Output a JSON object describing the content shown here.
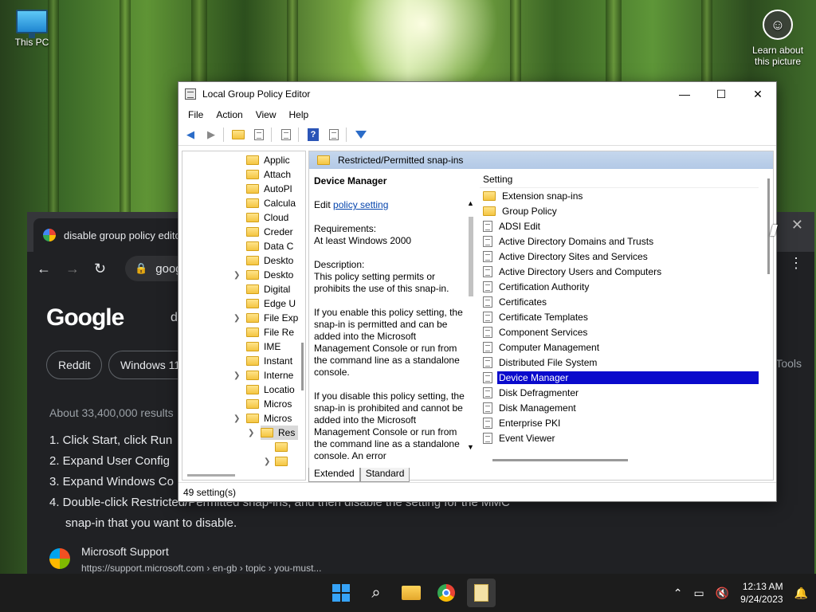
{
  "desktop": {
    "this_pc": "This PC",
    "learn_line1": "Learn about",
    "learn_line2": "this picture"
  },
  "chrome": {
    "tab_title": "disable group policy editor",
    "url": "google.",
    "google_logo": "Google",
    "search_partial": "d",
    "chips": [
      "Reddit",
      "Windows 11"
    ],
    "tools": "Tools",
    "results_count": "About 33,400,000 results",
    "steps": [
      "1. Click Start, click Run",
      "2. Expand User Config",
      "3. Expand Windows Co",
      "4. Double-click Restricted/Permitted snap-ins, and then disable the setting for the MMC",
      "snap-in that you want to disable."
    ],
    "ms_title": "Microsoft Support",
    "ms_url": "https://support.microsoft.com › en-gb › topic › you-must..."
  },
  "gpo": {
    "title": "Local Group Policy Editor",
    "menu": [
      "File",
      "Action",
      "View",
      "Help"
    ],
    "tree_items": [
      "Applic",
      "Attach",
      "AutoPl",
      "Calcula",
      "Cloud",
      "Creder",
      "Data C",
      "Deskto",
      "Deskto",
      "Digital",
      "Edge U",
      "File Exp",
      "File Re",
      "IME",
      "Instant",
      "Interne",
      "Locatio",
      "Micros",
      "Micros",
      "Res",
      "",
      ""
    ],
    "header_path": "Restricted/Permitted snap-ins",
    "desc": {
      "title": "Device Manager",
      "edit_prefix": "Edit ",
      "edit_link": "policy setting",
      "requirements_label": "Requirements:",
      "requirements": "At least Windows 2000",
      "description_label": "Description:",
      "description": "This policy setting permits or prohibits the use of this snap-in.",
      "enable": "If you enable this policy setting, the snap-in is permitted and can be added into the Microsoft Management Console or run from the command line as a standalone console.",
      "disable": "If you disable this policy setting, the snap-in is prohibited and cannot be added into the Microsoft Management Console or run from the command line as a standalone console. An error"
    },
    "list_header": "Setting",
    "settings": [
      {
        "label": "Extension snap-ins",
        "type": "folder"
      },
      {
        "label": "Group Policy",
        "type": "folder"
      },
      {
        "label": "ADSI Edit",
        "type": "doc"
      },
      {
        "label": "Active Directory Domains and Trusts",
        "type": "doc"
      },
      {
        "label": "Active Directory Sites and Services",
        "type": "doc"
      },
      {
        "label": "Active Directory Users and Computers",
        "type": "doc"
      },
      {
        "label": "Certification Authority",
        "type": "doc"
      },
      {
        "label": "Certificates",
        "type": "doc"
      },
      {
        "label": "Certificate Templates",
        "type": "doc"
      },
      {
        "label": "Component Services",
        "type": "doc"
      },
      {
        "label": "Computer Management",
        "type": "doc"
      },
      {
        "label": "Distributed File System",
        "type": "doc"
      },
      {
        "label": "Device Manager",
        "type": "doc",
        "selected": true
      },
      {
        "label": "Disk Defragmenter",
        "type": "doc"
      },
      {
        "label": "Disk Management",
        "type": "doc"
      },
      {
        "label": "Enterprise PKI",
        "type": "doc"
      },
      {
        "label": "Event Viewer",
        "type": "doc"
      }
    ],
    "tabs": [
      "Extended",
      "Standard"
    ],
    "status": "49 setting(s)"
  },
  "taskbar": {
    "time": "12:13 AM",
    "date": "9/24/2023"
  },
  "colors": {
    "selection": "#0a0acc",
    "header_band": "#b3c9e6",
    "taskbar": "#1c1c1c"
  }
}
